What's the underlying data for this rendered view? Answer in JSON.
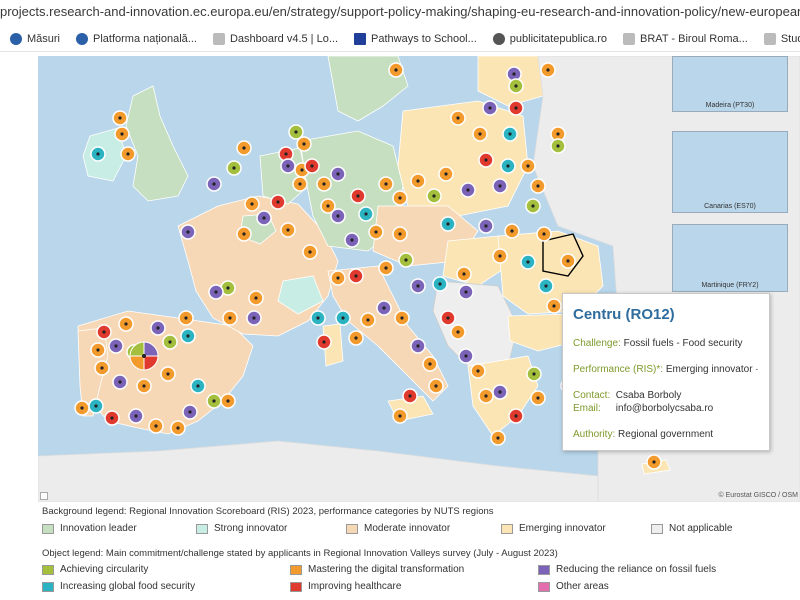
{
  "browser": {
    "url": "projects.research-and-innovation.ec.europa.eu/en/strategy/support-policy-making/shaping-eu-research-and-innovation-policy/new-european-innovation-agenda",
    "bookmarks": [
      {
        "label": "Măsuri",
        "icon": "gov-seal-icon",
        "color": "#2b5fa8"
      },
      {
        "label": "Platforma națională...",
        "icon": "gov-seal-icon",
        "color": "#2b5fa8"
      },
      {
        "label": "Dashboard v4.5 | Lo...",
        "icon": "page-icon",
        "color": "#888888"
      },
      {
        "label": "Pathways to School...",
        "icon": "eu-flag-icon",
        "color": "#1f3f99"
      },
      {
        "label": "publicitatepublica.ro",
        "icon": "globe-icon",
        "color": "#555555"
      },
      {
        "label": "BRAT - Biroul Roma...",
        "icon": "page-icon",
        "color": "#888888"
      },
      {
        "label": "Studiul Național de...",
        "icon": "page-icon",
        "color": "#888888"
      }
    ]
  },
  "map": {
    "insets": [
      {
        "label": "Madeira (PT30)"
      },
      {
        "label": "Canarias (ES70)"
      },
      {
        "label": "Martinique (FRY2)"
      }
    ],
    "credit": "© Eurostat GISCO / OSM",
    "colors": {
      "sea": "#b9d6ea",
      "land_outside": "#ececec",
      "innovation_leader": "#c5dfc0",
      "strong_innovator": "#c7ede4",
      "moderate_innovator": "#f7d8b6",
      "emerging_innovator": "#fbe5b4",
      "not_applicable": "#eeeeee",
      "achieving_circularity": "#a4bf3d",
      "digital_transformation": "#f39a2d",
      "fossil_fuels": "#7b63b8",
      "food_security": "#2bb3c2",
      "healthcare": "#e03a2e",
      "other_areas": "#e36eae"
    }
  },
  "tooltip": {
    "region": "Centru (RO12)",
    "challenge_label": "Challenge:",
    "challenge_value": "Fossil fuels - Food security",
    "performance_label": "Performance (RIS)*:",
    "performance_value": "Emerging innovator ·",
    "contact_label": "Contact:",
    "contact_value": "Csaba Borboly",
    "email_label": "Email:",
    "email_value": "info@borbolycsaba.ro",
    "authority_label": "Authority:",
    "authority_value": "Regional government"
  },
  "legend": {
    "background_title": "Background legend: Regional Innovation Scoreboard (RIS) 2023, performance categories by NUTS  regions",
    "background_items": [
      {
        "label": "Innovation leader",
        "color": "#c5dfc0"
      },
      {
        "label": "Strong innovator",
        "color": "#c7ede4"
      },
      {
        "label": "Moderate innovator",
        "color": "#f7d8b6"
      },
      {
        "label": "Emerging innovator",
        "color": "#fbe5b4"
      },
      {
        "label": "Not applicable",
        "color": "#eeeeee"
      }
    ],
    "object_title": "Object legend: Main commitment/challenge stated by applicants in Regional Innovation Valleys survey (July - August 2023)",
    "object_items": [
      {
        "label": "Achieving circularity",
        "color": "#a4bf3d"
      },
      {
        "label": "Mastering the digital transformation",
        "color": "#f39a2d"
      },
      {
        "label": "Reducing the reliance on fossil fuels",
        "color": "#7b63b8"
      },
      {
        "label": "Increasing global food security",
        "color": "#2bb3c2"
      },
      {
        "label": "Improving healthcare",
        "color": "#e03a2e"
      },
      {
        "label": "Other areas",
        "color": "#e36eae"
      }
    ]
  }
}
